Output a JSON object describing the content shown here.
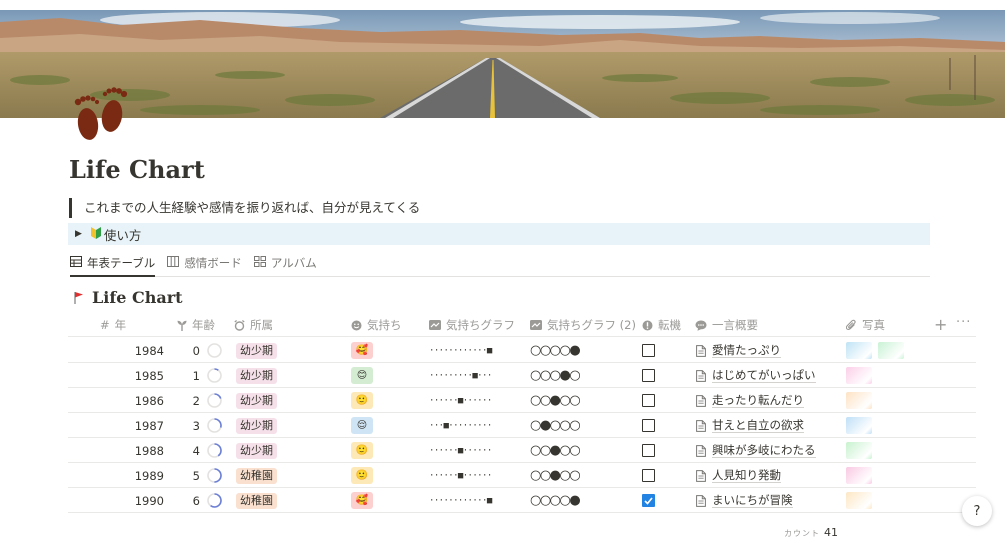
{
  "cover": {
    "image": "desert-road-landscape"
  },
  "page": {
    "icon": "footprints-icon",
    "title": "Life Chart",
    "quote": "これまでの人生経験や感情を振り返れば、自分が見えてくる",
    "toggle": {
      "icon": "beginner-mark-icon",
      "label": "使い方"
    }
  },
  "views": [
    {
      "icon": "table-icon",
      "label": "年表テーブル",
      "active": true
    },
    {
      "icon": "board-icon",
      "label": "感情ボード",
      "active": false
    },
    {
      "icon": "gallery-icon",
      "label": "アルバム",
      "active": false
    }
  ],
  "database": {
    "icon": "flag-icon",
    "title": "Life Chart",
    "columns": [
      {
        "icon": "hash-icon",
        "label": "年"
      },
      {
        "icon": "sprout-icon",
        "label": "年齢"
      },
      {
        "icon": "alarm-icon",
        "label": "所属"
      },
      {
        "icon": "smile-icon",
        "label": "気持ち"
      },
      {
        "icon": "chart-icon",
        "label": "気持ちグラフ"
      },
      {
        "icon": "chart-icon",
        "label": "気持ちグラフ (2)"
      },
      {
        "icon": "exclamation-icon",
        "label": "転機"
      },
      {
        "icon": "speech-icon",
        "label": "一言概要"
      },
      {
        "icon": "paperclip-icon",
        "label": "写真"
      }
    ],
    "add_label": "+",
    "more_label": "···",
    "rows": [
      {
        "year": "1984",
        "age": "0",
        "progress": 0.0,
        "stage": "幼少期",
        "stage_color": "#f5e0e9",
        "mood": "🥰",
        "mood_bg": "#fdd0d0",
        "graph": "············■",
        "graph2": "○○○○●",
        "turning": false,
        "summary": "愛情たっぷり",
        "photos": [
          "#bfe3f5",
          "#c9f2d5"
        ]
      },
      {
        "year": "1985",
        "age": "1",
        "progress": 0.1,
        "stage": "幼少期",
        "stage_color": "#f5e0e9",
        "mood": "😊",
        "mood_bg": "#d4ecd2",
        "graph": "·········■···",
        "graph2": "○○○●○",
        "turning": false,
        "summary": "はじめてがいっぱい",
        "photos": [
          "#fbcfe8"
        ]
      },
      {
        "year": "1986",
        "age": "2",
        "progress": 0.2,
        "stage": "幼少期",
        "stage_color": "#f5e0e9",
        "mood": "🙂",
        "mood_bg": "#fde9b8",
        "graph": "······■······",
        "graph2": "○○●○○",
        "turning": false,
        "summary": "走ったり転んだり",
        "photos": [
          "#fde2c4"
        ]
      },
      {
        "year": "1987",
        "age": "3",
        "progress": 0.3,
        "stage": "幼少期",
        "stage_color": "#f5e0e9",
        "mood": "😌",
        "mood_bg": "#cfe5f5",
        "graph": "···■·········",
        "graph2": "○●○○○",
        "turning": false,
        "summary": "甘えと自立の欲求",
        "photos": [
          "#bfdff7"
        ]
      },
      {
        "year": "1988",
        "age": "4",
        "progress": 0.4,
        "stage": "幼少期",
        "stage_color": "#f5e0e9",
        "mood": "🙂",
        "mood_bg": "#fde9b8",
        "graph": "······■······",
        "graph2": "○○●○○",
        "turning": false,
        "summary": "興味が多岐にわたる",
        "photos": [
          "#c8f2cf"
        ]
      },
      {
        "year": "1989",
        "age": "5",
        "progress": 0.5,
        "stage": "幼稚園",
        "stage_color": "#fae0cf",
        "mood": "🙂",
        "mood_bg": "#fde9b8",
        "graph": "······■······",
        "graph2": "○○●○○",
        "turning": false,
        "summary": "人見知り発動",
        "photos": [
          "#f9c9e3"
        ]
      },
      {
        "year": "1990",
        "age": "6",
        "progress": 0.6,
        "stage": "幼稚園",
        "stage_color": "#fae0cf",
        "mood": "🥰",
        "mood_bg": "#fdd0d0",
        "graph": "············■",
        "graph2": "○○○○●",
        "turning": true,
        "summary": "まいにちが冒険",
        "photos": [
          "#fde7c4"
        ]
      }
    ]
  },
  "footer": {
    "count_label": "カウント",
    "count_value": "41"
  },
  "help": {
    "label": "?"
  }
}
